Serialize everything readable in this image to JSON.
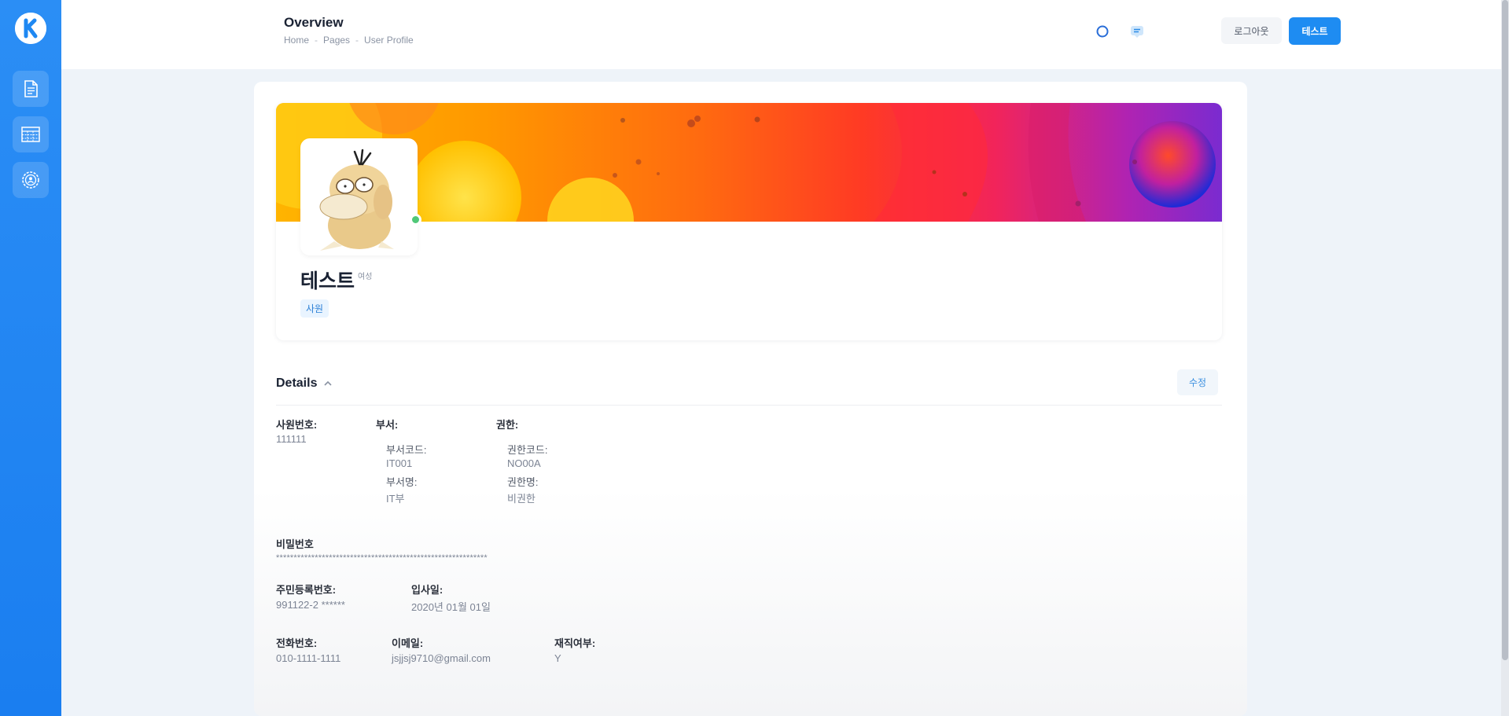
{
  "header": {
    "title": "Overview",
    "breadcrumb": [
      "Home",
      "Pages",
      "User Profile"
    ],
    "sep": "-",
    "logout_label": "로그아웃",
    "user_label": "테스트"
  },
  "sidebar": {
    "items": [
      {
        "icon": "document-icon"
      },
      {
        "icon": "table-icon"
      },
      {
        "icon": "settings-user-icon"
      }
    ]
  },
  "profile": {
    "name": "테스트",
    "gender": "여성",
    "role": "사원",
    "online": true
  },
  "details": {
    "title": "Details",
    "edit_label": "수정",
    "employee_no": {
      "label": "사원번호:",
      "value": "111111"
    },
    "dept": {
      "label": "부서:",
      "code_label": "부서코드:",
      "code": "IT001",
      "name_label": "부서명:",
      "name": "IT부"
    },
    "auth": {
      "label": "권한:",
      "code_label": "권한코드:",
      "code": "NO00A",
      "name_label": "권한명:",
      "name": "비권한"
    },
    "password": {
      "label": "비밀번호",
      "value": "************************************************************"
    },
    "resident_no": {
      "label": "주민등록번호:",
      "value": "991122-2 ******"
    },
    "join_date": {
      "label": "입사일:",
      "value": "2020년 01월 01일"
    },
    "phone": {
      "label": "전화번호:",
      "value": "010-1111-1111"
    },
    "email": {
      "label": "이메일:",
      "value": "jsjjsj9710@gmail.com"
    },
    "employed": {
      "label": "재직여부:",
      "value": "Y"
    }
  },
  "colors": {
    "sidebar": "#1e88f2",
    "primary": "#1e8cf2",
    "online": "#50c878"
  }
}
